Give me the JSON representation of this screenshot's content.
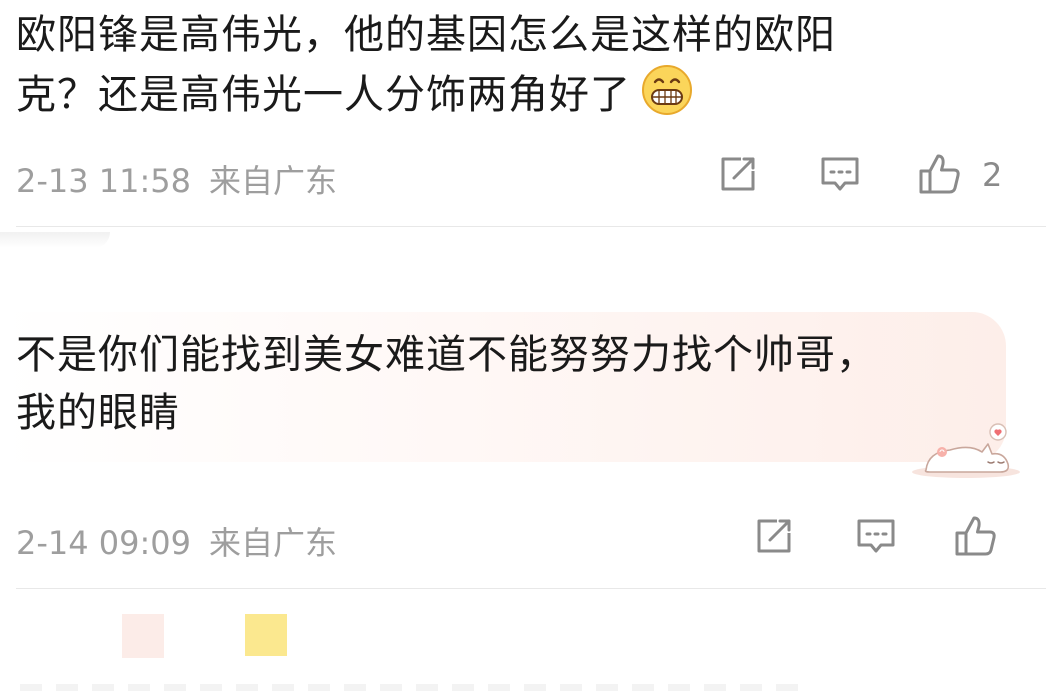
{
  "comments": [
    {
      "text_lines": [
        "欧阳锋是高伟光，他的基因怎么是这样的欧阳",
        "克？还是高伟光一人分饰两角好了"
      ],
      "emoji": "grinning-face-icon",
      "time": "2-13 11:58",
      "location": "来自广东",
      "likes": "2"
    },
    {
      "text_lines": [
        "不是你们能找到美女难道不能努努力找个帅哥，",
        "我的眼睛"
      ],
      "time": "2-14 09:09",
      "location": "来自广东",
      "likes": ""
    }
  ],
  "icons": {
    "share": "share-icon",
    "reply": "reply-icon",
    "like": "thumbs-up-icon",
    "sticker": "sleeping-cat-sticker-icon"
  },
  "colors": {
    "text": "#1a1a1a",
    "meta": "#9e9e9e",
    "icon": "#8a8a8a",
    "bubble": "#fdeee9",
    "emoji": "#f7c948"
  }
}
